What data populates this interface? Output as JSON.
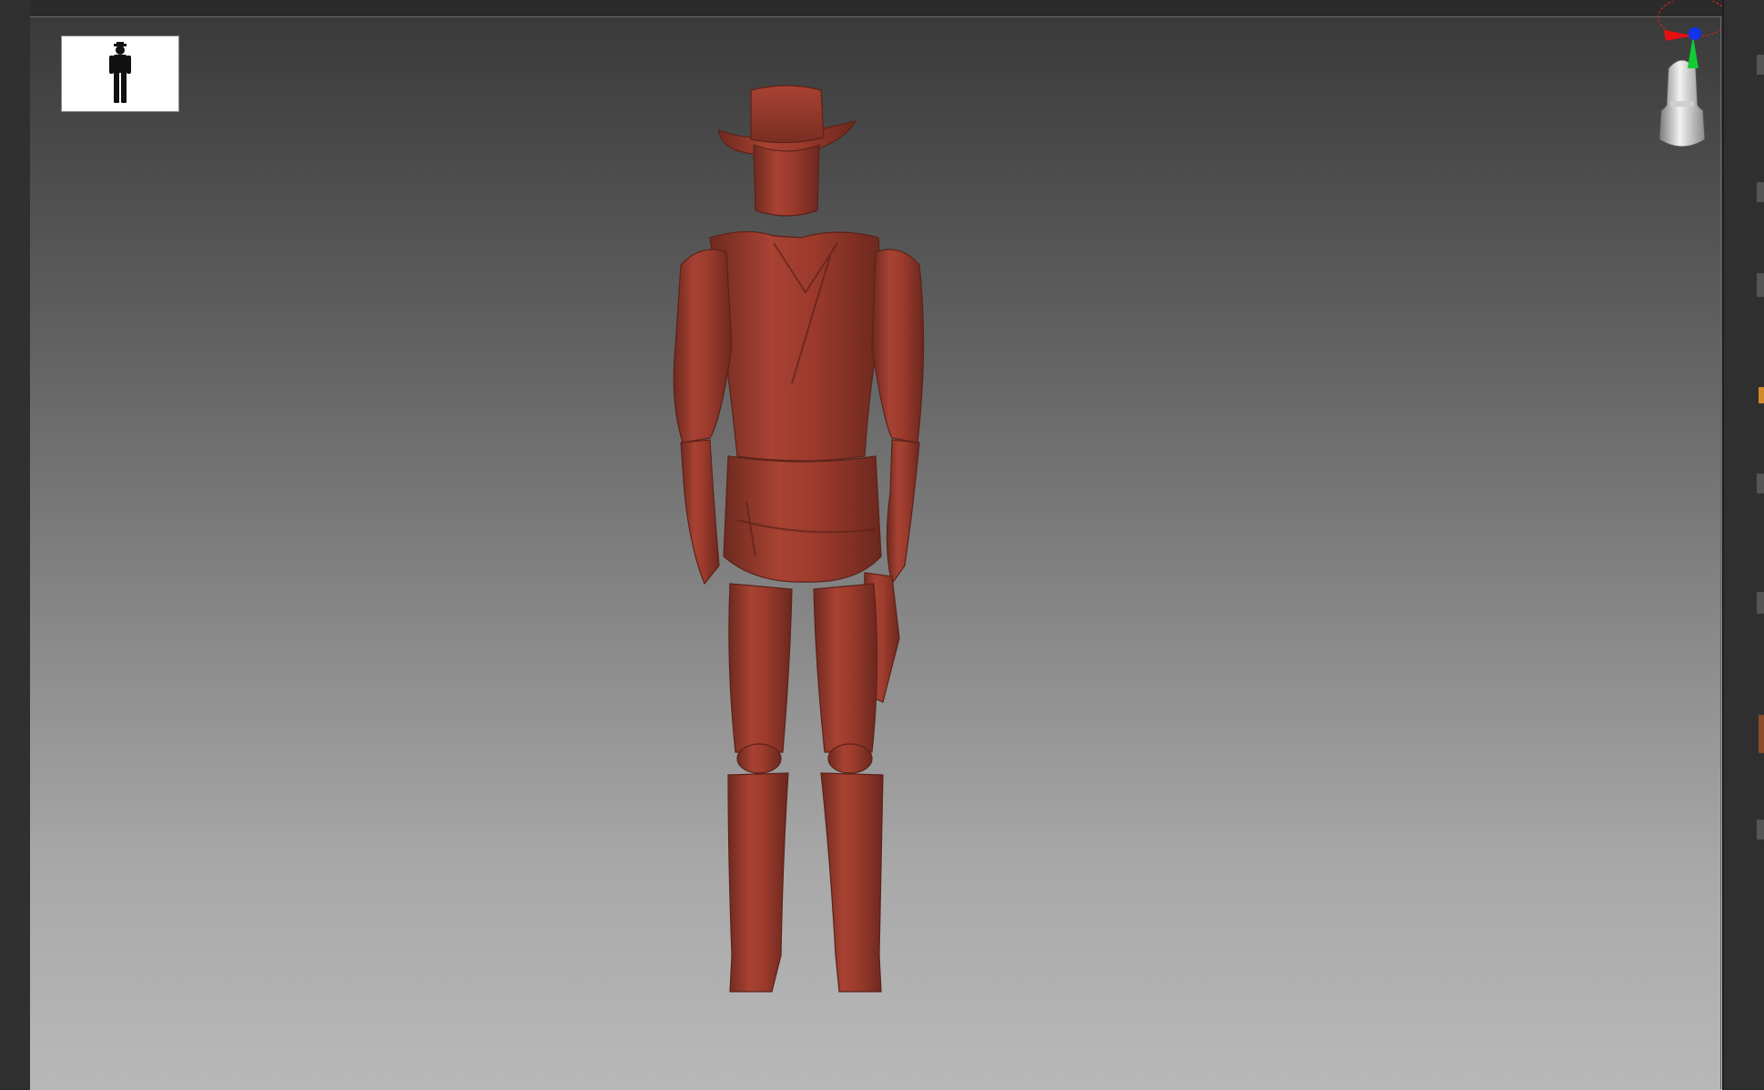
{
  "app": {
    "name": "",
    "background_color": "#2a2a2a"
  },
  "viewport": {
    "gradient_top": "#3a3a3a",
    "gradient_bottom": "#b8b8b8",
    "model": {
      "icon": "cowboy-figure-back-view",
      "material_color": "#9b3a2c"
    }
  },
  "thumbnail": {
    "icon": "figure-silhouette-icon"
  },
  "navigation": {
    "gizmo_icon": "axis-gizmo-icon",
    "gizmo_colors": {
      "x": "#ff0000",
      "y": "#00cc33",
      "z": "#0033ff"
    },
    "head_icon": "navigation-head-icon"
  },
  "right_panel": {
    "markers": [
      {
        "color": "#d38a2a"
      },
      {
        "color": "#8a4f2a"
      }
    ]
  }
}
